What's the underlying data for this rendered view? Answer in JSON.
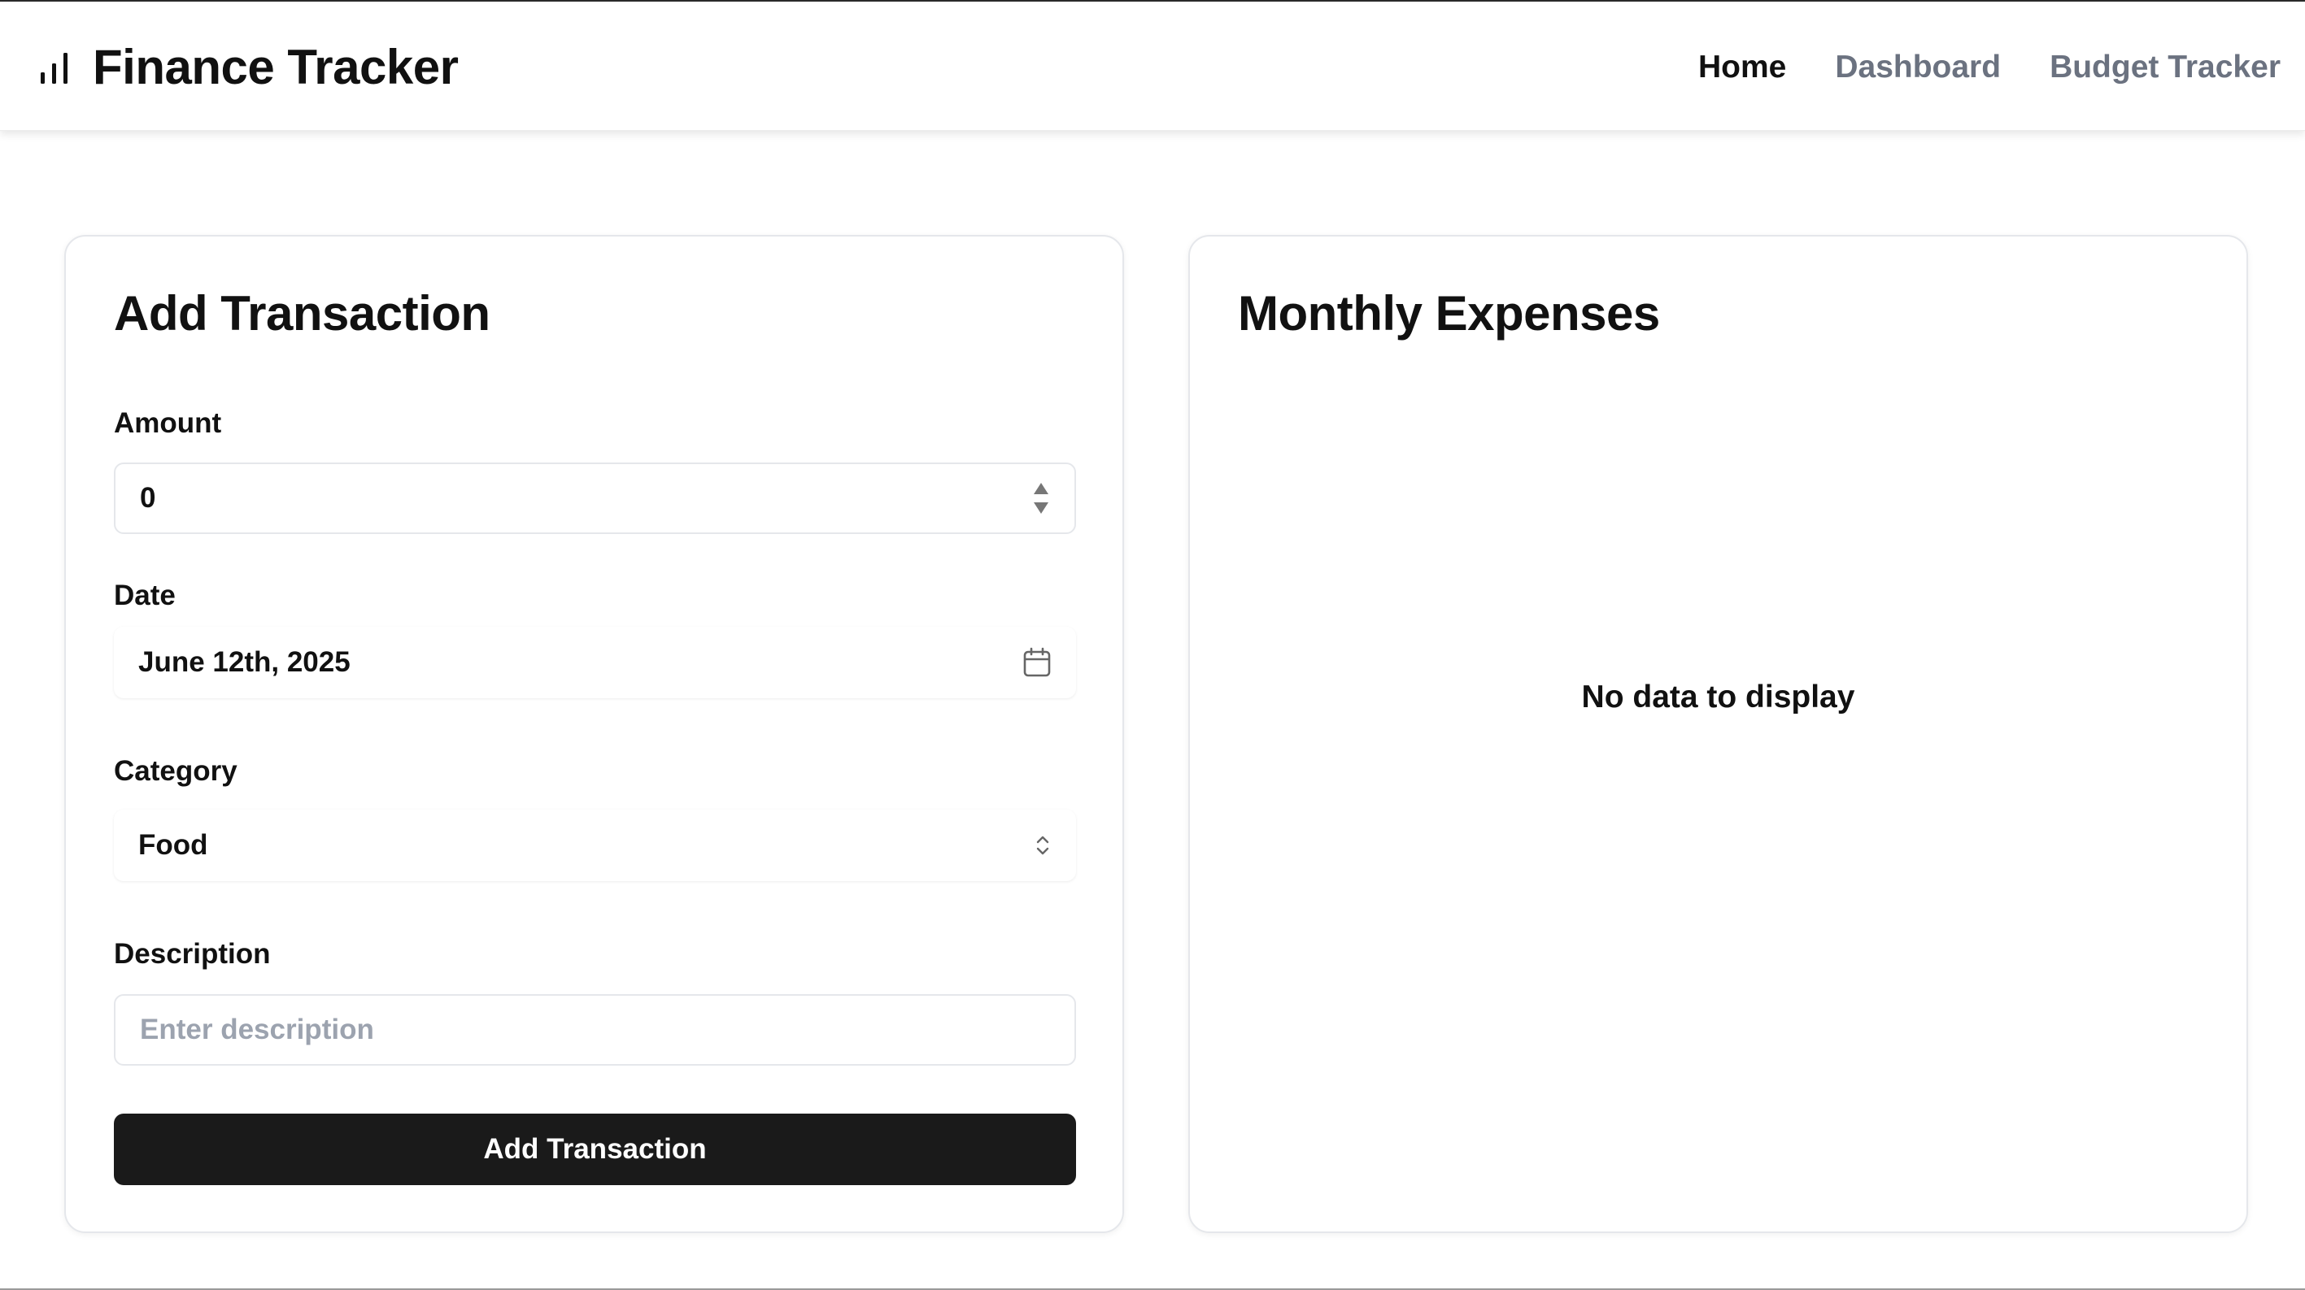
{
  "header": {
    "title": "Finance Tracker",
    "nav": [
      {
        "label": "Home",
        "active": true
      },
      {
        "label": "Dashboard",
        "active": false
      },
      {
        "label": "Budget Tracker",
        "active": false
      }
    ]
  },
  "add_transaction": {
    "title": "Add Transaction",
    "amount": {
      "label": "Amount",
      "value": "0"
    },
    "date": {
      "label": "Date",
      "value": "June 12th, 2025"
    },
    "category": {
      "label": "Category",
      "value": "Food"
    },
    "description": {
      "label": "Description",
      "placeholder": "Enter description",
      "value": ""
    },
    "submit_label": "Add Transaction"
  },
  "monthly_expenses": {
    "title": "Monthly Expenses",
    "empty_message": "No data to display"
  },
  "colors": {
    "primary_button": "#1a1a1a",
    "nav_inactive": "#6b7280",
    "placeholder": "#9ca3af",
    "border": "#e5e7eb"
  },
  "icons": {
    "brand": "bar-chart-icon",
    "amount": "spinner-arrows-icon",
    "date": "calendar-icon",
    "category": "chevron-up-down-icon"
  }
}
